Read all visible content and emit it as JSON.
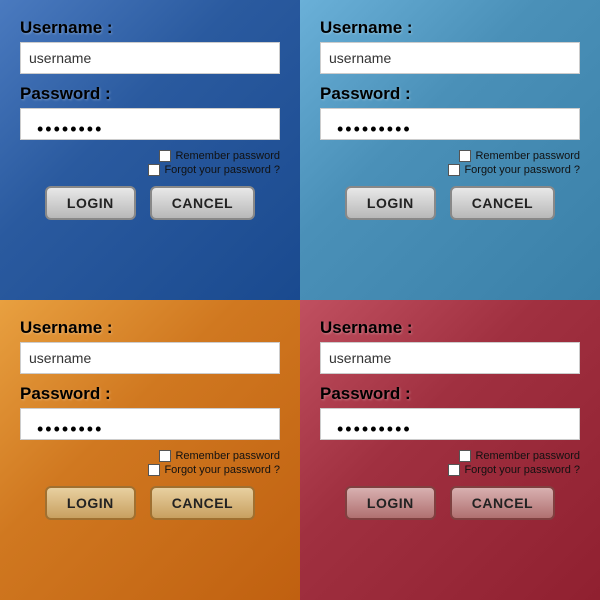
{
  "panels": [
    {
      "id": "panel-blue",
      "theme": "panel-blue",
      "username_label": "Username :",
      "username_placeholder": "username",
      "password_label": "Password :",
      "password_dots": "••••••••",
      "remember_label": "Remember password",
      "forgot_label": "Forgot your password ?",
      "login_label": "LOGIN",
      "cancel_label": "CANCEL"
    },
    {
      "id": "panel-light-blue",
      "theme": "panel-light-blue",
      "username_label": "Username :",
      "username_placeholder": "username",
      "password_label": "Password :",
      "password_dots": "•••••••••",
      "remember_label": "Remember password",
      "forgot_label": "Forgot your password ?",
      "login_label": "LOGIN",
      "cancel_label": "CANCEL"
    },
    {
      "id": "panel-orange",
      "theme": "panel-orange",
      "username_label": "Username :",
      "username_placeholder": "username",
      "password_label": "Password :",
      "password_dots": "••••••••",
      "remember_label": "Remember password",
      "forgot_label": "Forgot your password ?",
      "login_label": "LOGIN",
      "cancel_label": "CANCEL"
    },
    {
      "id": "panel-red",
      "theme": "panel-red",
      "username_label": "Username :",
      "username_placeholder": "username",
      "password_label": "Password :",
      "password_dots": "•••••••••",
      "remember_label": "Remember password",
      "forgot_label": "Forgot your password ?",
      "login_label": "LOGIN",
      "cancel_label": "CANCEL"
    }
  ]
}
